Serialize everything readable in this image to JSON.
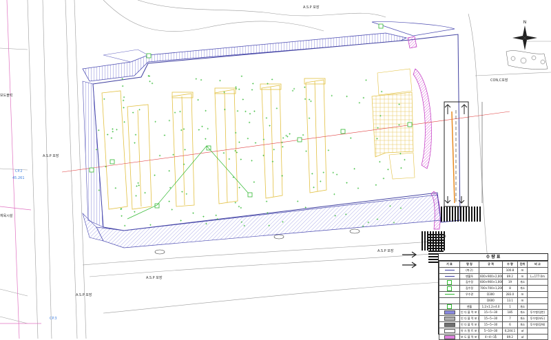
{
  "labels": {
    "asp_top": "A.S.P 포장",
    "asp_left1": "A.S.P 포장",
    "asp_left2": "A.S.P 포장",
    "asp_bottom1": "A.S.P 포장",
    "asp_bottom2": "A.S.P 포장",
    "con_road": "CON,C포장",
    "sidewalk": "보도블럭",
    "facility": "체육시설",
    "cp_top": "CP.2",
    "cp_top_val": "45.261",
    "cp_bottom": "CP.3"
  },
  "legend": {
    "title": "수 량 표",
    "headers": [
      "기 호",
      "명 칭",
      "규 격",
      "수 량",
      "단위",
      "비 고"
    ],
    "rows": [
      {
        "name": "(측구)",
        "spec": "",
        "qty": "100.8",
        "unit": "m",
        "note": "",
        "color": "#3a3aa0",
        "kind": "line"
      },
      {
        "name": "맨홀뚜",
        "spec": "600×900×2,000",
        "qty": "89.2",
        "unit": "m",
        "note": "L=177.0m",
        "color": "#3a3aa0",
        "kind": "line"
      },
      {
        "name": "집수정",
        "spec": "600×900×1,000",
        "qty": "19",
        "unit": "개소",
        "note": "",
        "color": "#2fb82f",
        "kind": "box"
      },
      {
        "name": "집수정",
        "spec": "700×700×1,200",
        "qty": "8",
        "unit": "개소",
        "note": "",
        "color": "#2fb82f",
        "kind": "box"
      },
      {
        "name": "우수관",
        "spec": "D300",
        "qty": "283.0",
        "unit": "m",
        "note": "",
        "color": "#2fb82f",
        "kind": "line"
      },
      {
        "name": "",
        "spec": "D600",
        "qty": "13.1",
        "unit": "m",
        "note": "",
        "color": "#2fb82f",
        "kind": "none"
      },
      {
        "name": "맨홀",
        "spec": "1.2×1.2×4.0",
        "qty": "1",
        "unit": "개소",
        "note": "",
        "color": "#2fb82f",
        "kind": "box"
      },
      {
        "name": "인 다 블 럭 포 장",
        "spec": "15~5~30",
        "qty": "185",
        "unit": "개소",
        "note": "투수형(일반)",
        "color": "#8a8ae0",
        "kind": "fill"
      },
      {
        "name": "인 다 블 럭 포 장",
        "spec": "15~5~30",
        "qty": "7",
        "unit": "개소",
        "note": "투수형(보도)",
        "color": "#b0b0b0",
        "kind": "fill"
      },
      {
        "name": "인 다 블 럭 포 장",
        "spec": "15~5~30",
        "qty": "6",
        "unit": "개소",
        "note": "투수형(장애)",
        "color": "#707070",
        "kind": "fill"
      },
      {
        "name": "아 스 팔 트 포 장",
        "spec": "5~10~30",
        "qty": "6,244.1",
        "unit": "㎡",
        "note": "",
        "color": "#ffffff",
        "kind": "fill"
      },
      {
        "name": "보 도 블 럭 포 장",
        "spec": "4~4~15",
        "qty": "89.2",
        "unit": "㎡",
        "note": "",
        "color": "#e080e0",
        "kind": "fill"
      }
    ]
  }
}
